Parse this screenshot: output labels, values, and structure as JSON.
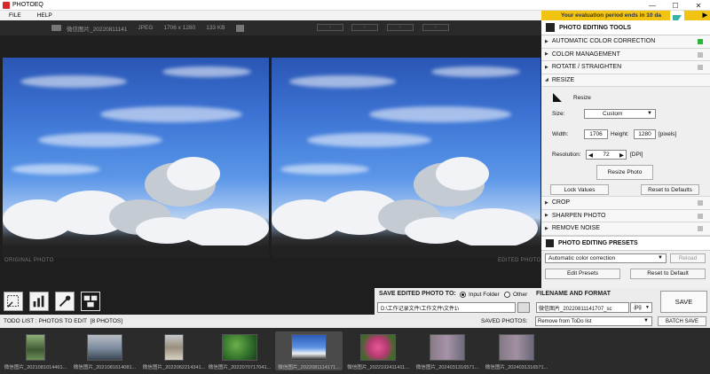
{
  "app": {
    "title": "PHOTOEQ"
  },
  "menu": [
    "FILE",
    "HELP"
  ],
  "window": {
    "minimize_glyph": "—",
    "maximize_glyph": "☐",
    "close_glyph": "✕"
  },
  "eval_banner": {
    "text": "Your evaluation period ends in 10 da",
    "arrow": "▶"
  },
  "photo_info": {
    "filename": "微信图片_20220811141",
    "format": "JPEG",
    "dimensions": "1706 x 1280",
    "size": "133 KB"
  },
  "view_buttons": [
    "-",
    "-",
    "-",
    "-"
  ],
  "labels": {
    "original": "ORIGINAL PHOTO",
    "edited": "EDITED PHOTO"
  },
  "panel": {
    "title": "PHOTO EDITING TOOLS",
    "sections": [
      {
        "label": "AUTOMATIC COLOR CORRECTION",
        "expanded": false,
        "active": true
      },
      {
        "label": "COLOR MANAGEMENT",
        "expanded": false,
        "active": false
      },
      {
        "label": "ROTATE / STRAIGHTEN",
        "expanded": false,
        "active": false
      },
      {
        "label": "RESIZE",
        "expanded": true,
        "active": false
      }
    ],
    "resize": {
      "title": "Resize",
      "size_label": "Size:",
      "size_value": "Custom",
      "width_label": "Width:",
      "width_value": "1706",
      "height_label": "Height:",
      "height_value": "1280",
      "units": "[pixels]",
      "resolution_label": "Resolution:",
      "resolution_value": "72",
      "resolution_units": "[DPI]",
      "resize_button": "Resize Photo",
      "lock_button": "Lock Values",
      "reset_button": "Reset to Defaults"
    },
    "sections_after": [
      {
        "label": "CROP"
      },
      {
        "label": "SHARPEN PHOTO"
      },
      {
        "label": "REMOVE NOISE"
      }
    ],
    "presets": {
      "title": "PHOTO EDITING PRESETS",
      "selected": "Automatic color correction",
      "reload": "Reload",
      "edit": "Edit Presets",
      "reset": "Reset to Default"
    }
  },
  "tools": [
    "select-tool",
    "levels-tool",
    "eyedropper-tool",
    "compare-tool"
  ],
  "save": {
    "title": "SAVE EDITED PHOTO TO:",
    "option_input": "Input Folder",
    "option_other": "Other",
    "path": "D:\\工作记录文件\\工作文件\\文件1\\",
    "filename_title": "FILENAME AND FORMAT",
    "filename": "微信图片_20220811141707_sc",
    "format": ".jpg",
    "save_button": "SAVE"
  },
  "todo": {
    "label": "TODO LIST : PHOTOS TO EDIT",
    "count": "[8 PHOTOS]",
    "saved_label": "SAVED PHOTOS:",
    "saved_option": "Remove from ToDo list",
    "batch_button": "BATCH SAVE"
  },
  "thumbnails": [
    {
      "caption": "微信图片_2021081014461...",
      "selected": false
    },
    {
      "caption": "微信图片_2021081614081...",
      "selected": false
    },
    {
      "caption": "微信图片_2022062214341...",
      "selected": false
    },
    {
      "caption": "微信图片_2022070717041...",
      "selected": false
    },
    {
      "caption": "微信图片_2022081114171...",
      "selected": true
    },
    {
      "caption": "微信图片_2022102411411...",
      "selected": false
    },
    {
      "caption": "微信图片_2024031316571...",
      "selected": false
    },
    {
      "caption": "微信图片_2024031316571...",
      "selected": false
    }
  ]
}
